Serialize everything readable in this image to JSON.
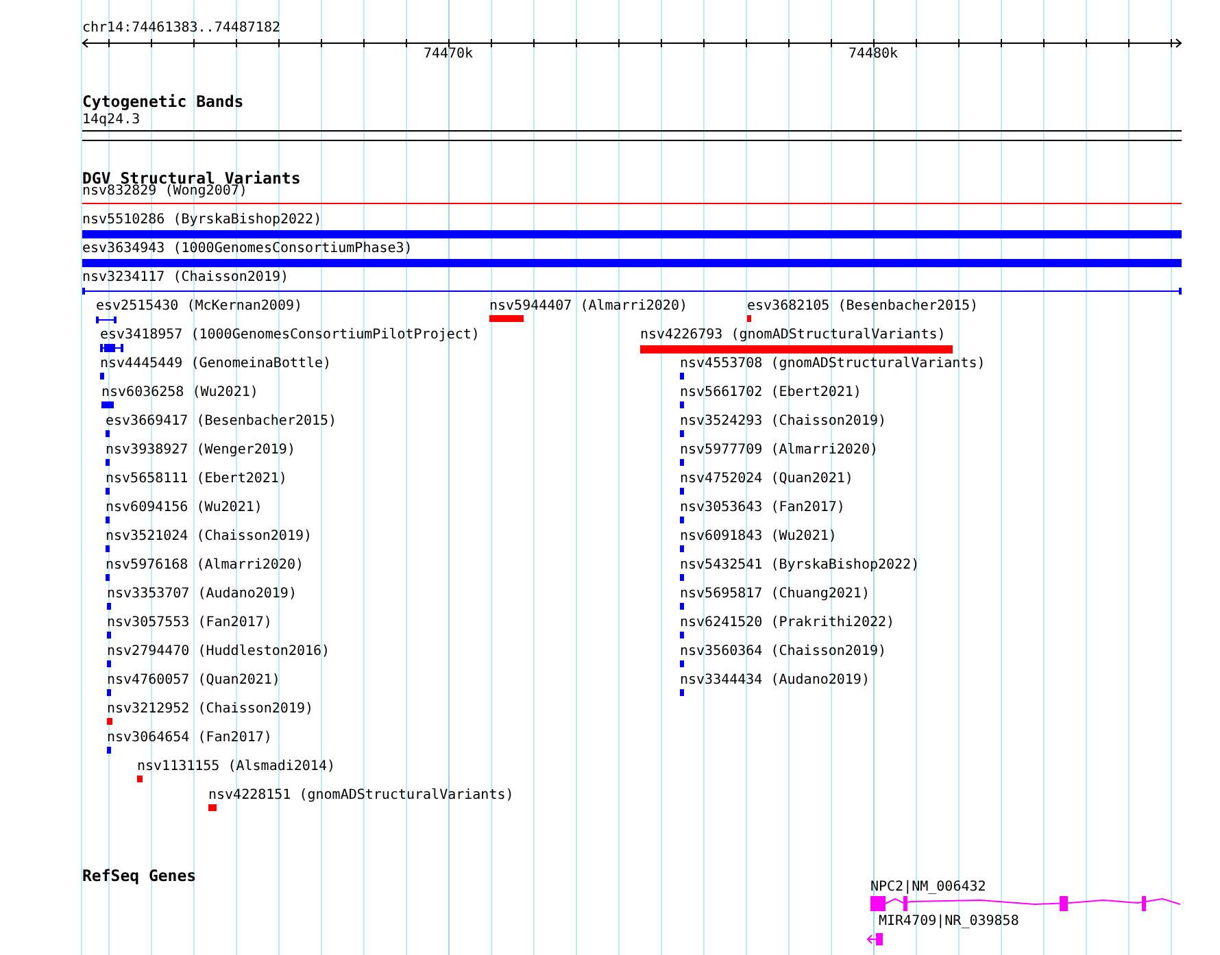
{
  "ruler": {
    "location": "chr14:74461383..74487182",
    "ticks": [
      "74470k",
      "74480k"
    ]
  },
  "tracks": [
    {
      "kind": "cytoband",
      "title": "Cytogenetic Bands",
      "features": [
        {
          "label": "14q24.3",
          "kind": "band"
        }
      ]
    },
    {
      "kind": "variants",
      "title": "DGV Structural Variants",
      "features": [
        {
          "label": "nsv832829 (Wong2007)",
          "kind": "line",
          "color": "#ff0000"
        },
        {
          "label": "nsv5510286 (ByrskaBishop2022)",
          "kind": "bar",
          "color": "#0000ff"
        },
        {
          "label": "esv3634943 (1000GenomesConsortiumPhase3)",
          "kind": "bar",
          "color": "#0000ff"
        },
        {
          "label": "nsv3234117 (Chaisson2019)",
          "kind": "interval",
          "color": "#0000ff"
        },
        {
          "label": "esv2515430 (McKernan2009)",
          "kind": "interval",
          "color": "#0000ff"
        },
        {
          "label": "nsv5944407 (Almarri2020)",
          "kind": "bar",
          "color": "#ff0000"
        },
        {
          "label": "esv3682105 (Besenbacher2015)",
          "kind": "bar",
          "color": "#ff0000"
        },
        {
          "label": "esv3418957 (1000GenomesConsortiumPilotProject)",
          "kind": "capped-bar",
          "color": "#0000ff"
        },
        {
          "label": "nsv4226793 (gnomADStructuralVariants)",
          "kind": "bar",
          "color": "#ff0000"
        },
        {
          "label": "nsv4445449 (GenomeinaBottle)",
          "kind": "bar",
          "color": "#0000ff"
        },
        {
          "label": "nsv4553708 (gnomADStructuralVariants)",
          "kind": "bar",
          "color": "#0000ff"
        },
        {
          "label": "nsv6036258 (Wu2021)",
          "kind": "bar",
          "color": "#0000ff"
        },
        {
          "label": "nsv5661702 (Ebert2021)",
          "kind": "bar",
          "color": "#0000ff"
        },
        {
          "label": "esv3669417 (Besenbacher2015)",
          "kind": "bar",
          "color": "#0000ff"
        },
        {
          "label": "nsv3524293 (Chaisson2019)",
          "kind": "bar",
          "color": "#0000ff"
        },
        {
          "label": "nsv3938927 (Wenger2019)",
          "kind": "bar",
          "color": "#0000ff"
        },
        {
          "label": "nsv5977709 (Almarri2020)",
          "kind": "bar",
          "color": "#0000ff"
        },
        {
          "label": "nsv5658111 (Ebert2021)",
          "kind": "bar",
          "color": "#0000ff"
        },
        {
          "label": "nsv4752024 (Quan2021)",
          "kind": "bar",
          "color": "#0000ff"
        },
        {
          "label": "nsv6094156 (Wu2021)",
          "kind": "bar",
          "color": "#0000ff"
        },
        {
          "label": "nsv3053643 (Fan2017)",
          "kind": "bar",
          "color": "#0000ff"
        },
        {
          "label": "nsv3521024 (Chaisson2019)",
          "kind": "bar",
          "color": "#0000ff"
        },
        {
          "label": "nsv6091843 (Wu2021)",
          "kind": "bar",
          "color": "#0000ff"
        },
        {
          "label": "nsv5976168 (Almarri2020)",
          "kind": "bar",
          "color": "#0000ff"
        },
        {
          "label": "nsv5432541 (ByrskaBishop2022)",
          "kind": "bar",
          "color": "#0000ff"
        },
        {
          "label": "nsv3353707 (Audano2019)",
          "kind": "bar",
          "color": "#0000ff"
        },
        {
          "label": "nsv5695817 (Chuang2021)",
          "kind": "bar",
          "color": "#0000ff"
        },
        {
          "label": "nsv3057553 (Fan2017)",
          "kind": "bar",
          "color": "#0000ff"
        },
        {
          "label": "nsv6241520 (Prakrithi2022)",
          "kind": "bar",
          "color": "#0000ff"
        },
        {
          "label": "nsv2794470 (Huddleston2016)",
          "kind": "bar",
          "color": "#0000ff"
        },
        {
          "label": "nsv3560364 (Chaisson2019)",
          "kind": "bar",
          "color": "#0000ff"
        },
        {
          "label": "nsv4760057 (Quan2021)",
          "kind": "bar",
          "color": "#0000ff"
        },
        {
          "label": "nsv3344434 (Audano2019)",
          "kind": "bar",
          "color": "#0000ff"
        },
        {
          "label": "nsv3212952 (Chaisson2019)",
          "kind": "bar",
          "color": "#ff0000"
        },
        {
          "label": "nsv3064654 (Fan2017)",
          "kind": "bar",
          "color": "#0000ff"
        },
        {
          "label": "nsv1131155 (Alsmadi2014)",
          "kind": "bar",
          "color": "#ff0000"
        },
        {
          "label": "nsv4228151 (gnomADStructuralVariants)",
          "kind": "bar",
          "color": "#ff0000"
        }
      ]
    },
    {
      "kind": "genes",
      "title": "RefSeq Genes",
      "features": [
        {
          "label": "NPC2|NM_006432",
          "kind": "gene"
        },
        {
          "label": "MIR4709|NR_039858",
          "kind": "mirna"
        }
      ]
    }
  ]
}
